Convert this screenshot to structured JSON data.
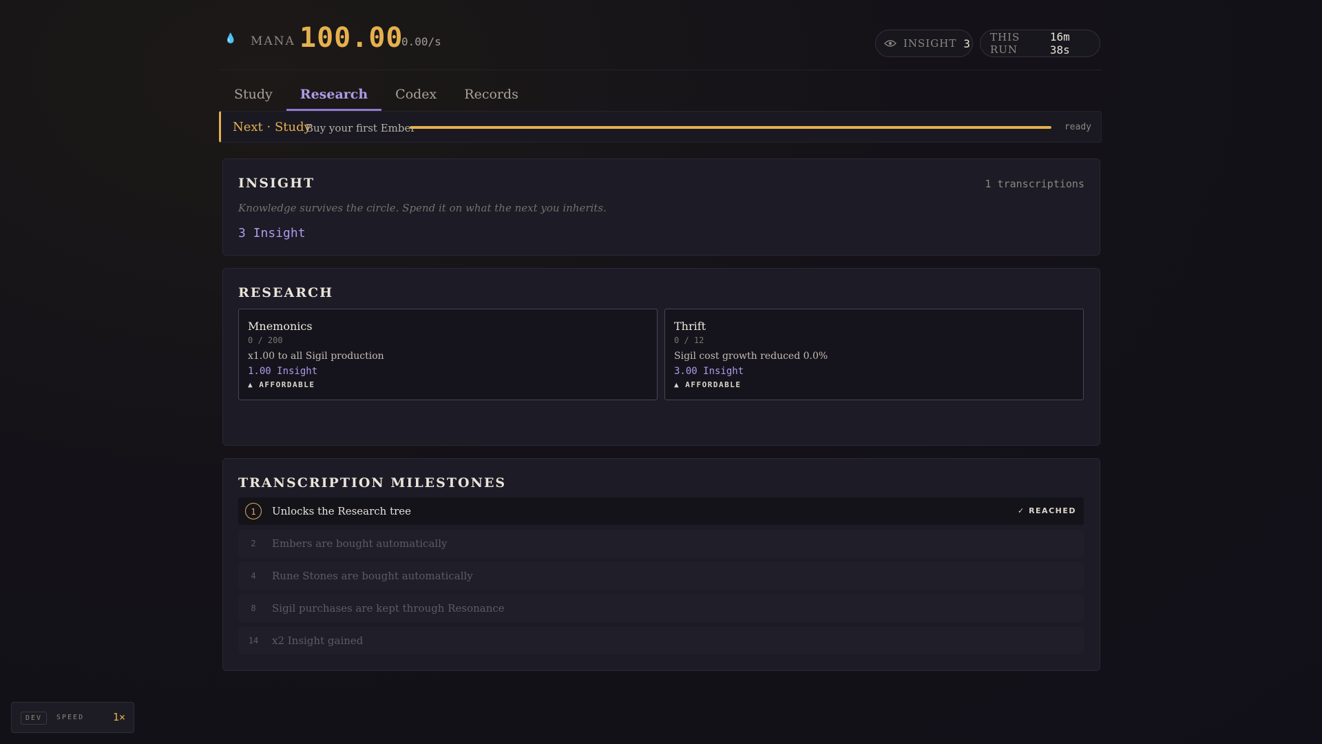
{
  "header": {
    "mana_label": "MANA",
    "mana_value": "100.00",
    "mana_rate": "0.00/s",
    "insight_label": "INSIGHT",
    "insight_value": "3",
    "run_label": "THIS RUN",
    "run_value": "16m 38s"
  },
  "tabs": [
    {
      "label": "Study"
    },
    {
      "label": "Research",
      "active": true
    },
    {
      "label": "Codex"
    },
    {
      "label": "Records"
    }
  ],
  "next": {
    "label": "Next · Study",
    "text": "Buy your first Ember",
    "progress": 1.0,
    "status": "ready"
  },
  "insight_card": {
    "title": "INSIGHT",
    "meta": "1 transcriptions",
    "description": "Knowledge survives the circle. Spend it on what the next you inherits.",
    "amount": "3 Insight"
  },
  "research_card": {
    "title": "RESEARCH",
    "nodes": [
      {
        "name": "Mnemonics",
        "level": "0 / 200",
        "effect": "x1.00 to all Sigil production",
        "cost": "1.00 Insight",
        "status": "▲ AFFORDABLE"
      },
      {
        "name": "Thrift",
        "level": "0 / 12",
        "effect": "Sigil cost growth reduced 0.0%",
        "cost": "3.00 Insight",
        "status": "▲ AFFORDABLE"
      }
    ]
  },
  "milestones_card": {
    "title": "TRANSCRIPTION MILESTONES",
    "reached_label": "✓ REACHED",
    "items": [
      {
        "num": "1",
        "text": "Unlocks the Research tree"
      },
      {
        "num": "2",
        "text": "Embers are bought automatically"
      },
      {
        "num": "4",
        "text": "Rune Stones are bought automatically"
      },
      {
        "num": "8",
        "text": "Sigil purchases are kept through Resonance"
      },
      {
        "num": "14",
        "text": "x2 Insight gained"
      }
    ]
  },
  "dev": {
    "tag": "DEV",
    "speed_label": "SPEED",
    "speed_value": "1×"
  },
  "colors": {
    "accent_gold": "#e6b04e",
    "accent_purple": "#b09ae8",
    "background": "#141218",
    "card": "#1c1b26"
  }
}
